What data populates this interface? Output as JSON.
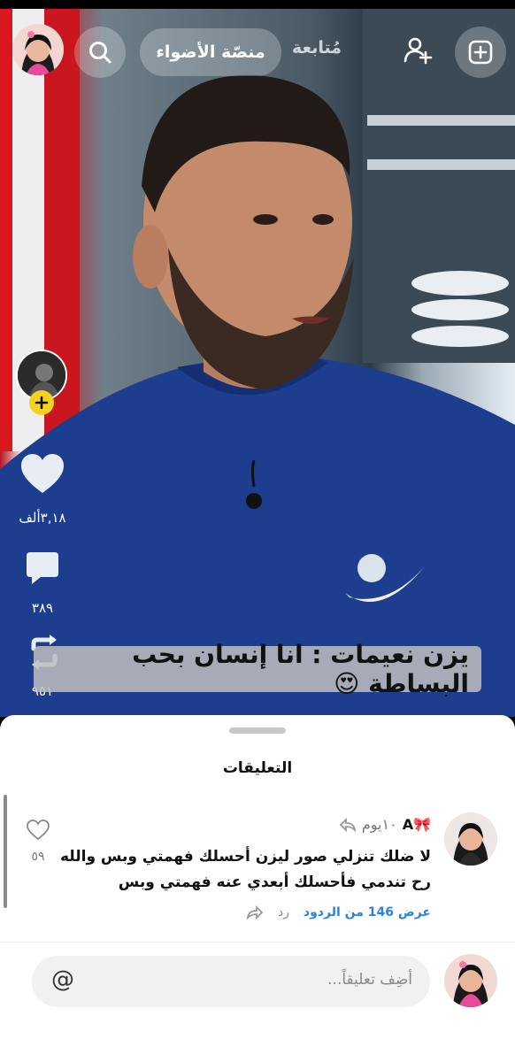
{
  "header": {
    "add_icon": "plus-square-icon",
    "add_friend_icon": "add-friend-icon",
    "tab_following": "مُتابعة",
    "tab_spotlight": "منصّة الأضواء",
    "search_icon": "search-icon"
  },
  "side_actions": {
    "likes": "٣,١٨ألف",
    "comments": "٣٨٩",
    "shares": "٩٥١"
  },
  "video": {
    "caption": "يزن نعيمات : انا إنسان بحب البساطة 😍"
  },
  "comments_sheet": {
    "title": "التعليقات",
    "comment": {
      "username": "🎀A",
      "time": "١٠يوم",
      "text_line1": "لا ضلك تنزلي صور ليزن أحسلك فهمتي وبس والله",
      "text_line2": "رح تندمي فأحسلك أبعدي عنه فهمتي وبس",
      "reply_label": "رد",
      "view_replies": "عرض 146 من الردود",
      "like_count": "٥٩"
    },
    "input_placeholder": "أضِف تعليقاً...",
    "at_symbol": "@"
  },
  "colors": {
    "accent_blue": "#2a84d8",
    "badge_yellow": "#f4d21f"
  }
}
